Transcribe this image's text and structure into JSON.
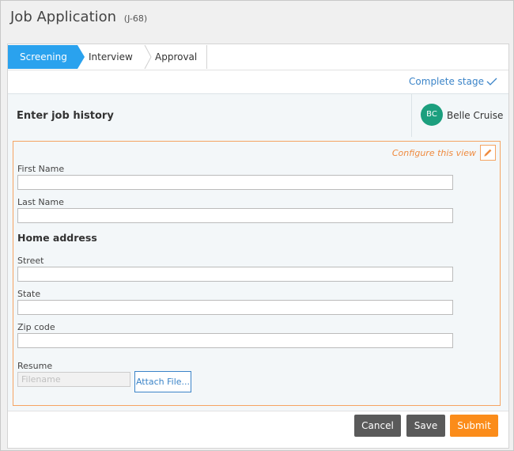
{
  "page": {
    "title": "Job Application",
    "case_id": "(J-68)"
  },
  "stages": [
    {
      "label": "Screening",
      "active": true
    },
    {
      "label": "Interview",
      "active": false
    },
    {
      "label": "Approval",
      "active": false
    }
  ],
  "complete_stage_label": "Complete stage",
  "assignment": {
    "title": "Enter job history",
    "assignee_initials": "BC",
    "assignee_name": "Belle Cruise"
  },
  "form": {
    "configure_label": "Configure this view",
    "first_name_label": "First Name",
    "first_name_value": "",
    "last_name_label": "Last Name",
    "last_name_value": "",
    "home_address_heading": "Home address",
    "street_label": "Street",
    "street_value": "",
    "state_label": "State",
    "state_value": "",
    "zip_label": "Zip code",
    "zip_value": "",
    "resume_label": "Resume",
    "filename_placeholder": "Filename",
    "attach_label": "Attach File..."
  },
  "actions": {
    "cancel": "Cancel",
    "save": "Save",
    "submit": "Submit"
  },
  "colors": {
    "accent": "#2aa2ee",
    "link": "#3b84c8",
    "config": "#ef8b3f",
    "submit": "#fb8c1a",
    "avatar": "#1c9f7e"
  },
  "icons": [
    "checkmark-icon",
    "pencil-icon"
  ]
}
